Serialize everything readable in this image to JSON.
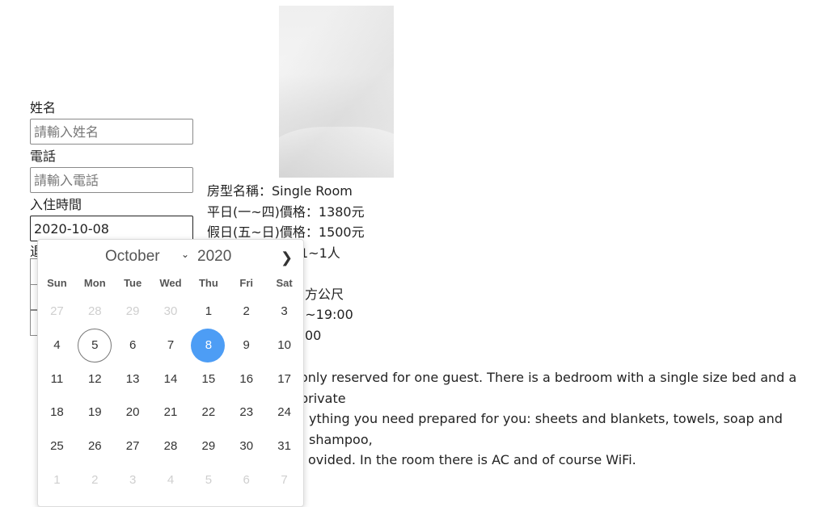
{
  "room": {
    "photo_alt": "white bed sheets",
    "lines": [
      "房型名稱：Single Room",
      "平日(一~四)價格：1380元",
      "假日(五~日)價格：1500元",
      "1~1人",
      "",
      "方公尺",
      ")~19:00",
      "00"
    ],
    "description_lines": [
      "only reserved for one guest. There is a bedroom with a single size bed and a private",
      "ything you need prepared for you: sheets and blankets, towels, soap and shampoo,",
      "ovided. In the room there is AC and of course WiFi."
    ]
  },
  "form": {
    "name_label": "姓名",
    "name_placeholder": "請輸入姓名",
    "phone_label": "電話",
    "phone_placeholder": "請輸入電話",
    "checkin_label": "入住時間",
    "checkin_value": "2020-10-08",
    "checkout_label_partial": "退"
  },
  "datepicker": {
    "month": "October",
    "year": "2020",
    "next_icon": "chevron-right-icon",
    "weekdays": [
      "Sun",
      "Mon",
      "Tue",
      "Wed",
      "Thu",
      "Fri",
      "Sat"
    ],
    "weeks": [
      [
        "27",
        "28",
        "29",
        "30",
        "1",
        "2",
        "3"
      ],
      [
        "4",
        "5",
        "6",
        "7",
        "8",
        "9",
        "10"
      ],
      [
        "11",
        "12",
        "13",
        "14",
        "15",
        "16",
        "17"
      ],
      [
        "18",
        "19",
        "20",
        "21",
        "22",
        "23",
        "24"
      ],
      [
        "25",
        "26",
        "27",
        "28",
        "29",
        "30",
        "31"
      ],
      [
        "1",
        "2",
        "3",
        "4",
        "5",
        "6",
        "7"
      ]
    ],
    "today": "5",
    "selected": "8",
    "selected_color": "#4d9df5"
  }
}
